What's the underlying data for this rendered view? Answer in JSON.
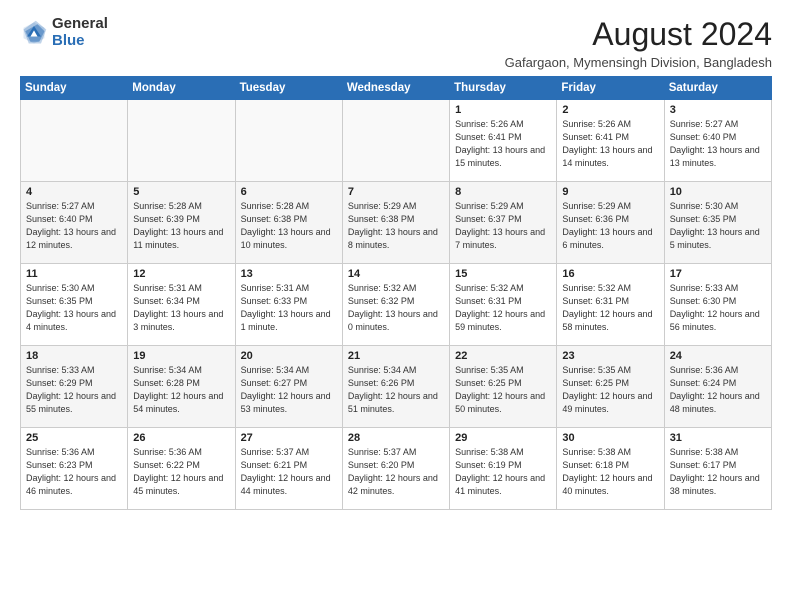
{
  "logo": {
    "general": "General",
    "blue": "Blue"
  },
  "title": "August 2024",
  "subtitle": "Gafargaon, Mymensingh Division, Bangladesh",
  "headers": [
    "Sunday",
    "Monday",
    "Tuesday",
    "Wednesday",
    "Thursday",
    "Friday",
    "Saturday"
  ],
  "weeks": [
    [
      {
        "day": "",
        "info": ""
      },
      {
        "day": "",
        "info": ""
      },
      {
        "day": "",
        "info": ""
      },
      {
        "day": "",
        "info": ""
      },
      {
        "day": "1",
        "info": "Sunrise: 5:26 AM\nSunset: 6:41 PM\nDaylight: 13 hours\nand 15 minutes."
      },
      {
        "day": "2",
        "info": "Sunrise: 5:26 AM\nSunset: 6:41 PM\nDaylight: 13 hours\nand 14 minutes."
      },
      {
        "day": "3",
        "info": "Sunrise: 5:27 AM\nSunset: 6:40 PM\nDaylight: 13 hours\nand 13 minutes."
      }
    ],
    [
      {
        "day": "4",
        "info": "Sunrise: 5:27 AM\nSunset: 6:40 PM\nDaylight: 13 hours\nand 12 minutes."
      },
      {
        "day": "5",
        "info": "Sunrise: 5:28 AM\nSunset: 6:39 PM\nDaylight: 13 hours\nand 11 minutes."
      },
      {
        "day": "6",
        "info": "Sunrise: 5:28 AM\nSunset: 6:38 PM\nDaylight: 13 hours\nand 10 minutes."
      },
      {
        "day": "7",
        "info": "Sunrise: 5:29 AM\nSunset: 6:38 PM\nDaylight: 13 hours\nand 8 minutes."
      },
      {
        "day": "8",
        "info": "Sunrise: 5:29 AM\nSunset: 6:37 PM\nDaylight: 13 hours\nand 7 minutes."
      },
      {
        "day": "9",
        "info": "Sunrise: 5:29 AM\nSunset: 6:36 PM\nDaylight: 13 hours\nand 6 minutes."
      },
      {
        "day": "10",
        "info": "Sunrise: 5:30 AM\nSunset: 6:35 PM\nDaylight: 13 hours\nand 5 minutes."
      }
    ],
    [
      {
        "day": "11",
        "info": "Sunrise: 5:30 AM\nSunset: 6:35 PM\nDaylight: 13 hours\nand 4 minutes."
      },
      {
        "day": "12",
        "info": "Sunrise: 5:31 AM\nSunset: 6:34 PM\nDaylight: 13 hours\nand 3 minutes."
      },
      {
        "day": "13",
        "info": "Sunrise: 5:31 AM\nSunset: 6:33 PM\nDaylight: 13 hours\nand 1 minute."
      },
      {
        "day": "14",
        "info": "Sunrise: 5:32 AM\nSunset: 6:32 PM\nDaylight: 13 hours\nand 0 minutes."
      },
      {
        "day": "15",
        "info": "Sunrise: 5:32 AM\nSunset: 6:31 PM\nDaylight: 12 hours\nand 59 minutes."
      },
      {
        "day": "16",
        "info": "Sunrise: 5:32 AM\nSunset: 6:31 PM\nDaylight: 12 hours\nand 58 minutes."
      },
      {
        "day": "17",
        "info": "Sunrise: 5:33 AM\nSunset: 6:30 PM\nDaylight: 12 hours\nand 56 minutes."
      }
    ],
    [
      {
        "day": "18",
        "info": "Sunrise: 5:33 AM\nSunset: 6:29 PM\nDaylight: 12 hours\nand 55 minutes."
      },
      {
        "day": "19",
        "info": "Sunrise: 5:34 AM\nSunset: 6:28 PM\nDaylight: 12 hours\nand 54 minutes."
      },
      {
        "day": "20",
        "info": "Sunrise: 5:34 AM\nSunset: 6:27 PM\nDaylight: 12 hours\nand 53 minutes."
      },
      {
        "day": "21",
        "info": "Sunrise: 5:34 AM\nSunset: 6:26 PM\nDaylight: 12 hours\nand 51 minutes."
      },
      {
        "day": "22",
        "info": "Sunrise: 5:35 AM\nSunset: 6:25 PM\nDaylight: 12 hours\nand 50 minutes."
      },
      {
        "day": "23",
        "info": "Sunrise: 5:35 AM\nSunset: 6:25 PM\nDaylight: 12 hours\nand 49 minutes."
      },
      {
        "day": "24",
        "info": "Sunrise: 5:36 AM\nSunset: 6:24 PM\nDaylight: 12 hours\nand 48 minutes."
      }
    ],
    [
      {
        "day": "25",
        "info": "Sunrise: 5:36 AM\nSunset: 6:23 PM\nDaylight: 12 hours\nand 46 minutes."
      },
      {
        "day": "26",
        "info": "Sunrise: 5:36 AM\nSunset: 6:22 PM\nDaylight: 12 hours\nand 45 minutes."
      },
      {
        "day": "27",
        "info": "Sunrise: 5:37 AM\nSunset: 6:21 PM\nDaylight: 12 hours\nand 44 minutes."
      },
      {
        "day": "28",
        "info": "Sunrise: 5:37 AM\nSunset: 6:20 PM\nDaylight: 12 hours\nand 42 minutes."
      },
      {
        "day": "29",
        "info": "Sunrise: 5:38 AM\nSunset: 6:19 PM\nDaylight: 12 hours\nand 41 minutes."
      },
      {
        "day": "30",
        "info": "Sunrise: 5:38 AM\nSunset: 6:18 PM\nDaylight: 12 hours\nand 40 minutes."
      },
      {
        "day": "31",
        "info": "Sunrise: 5:38 AM\nSunset: 6:17 PM\nDaylight: 12 hours\nand 38 minutes."
      }
    ]
  ]
}
